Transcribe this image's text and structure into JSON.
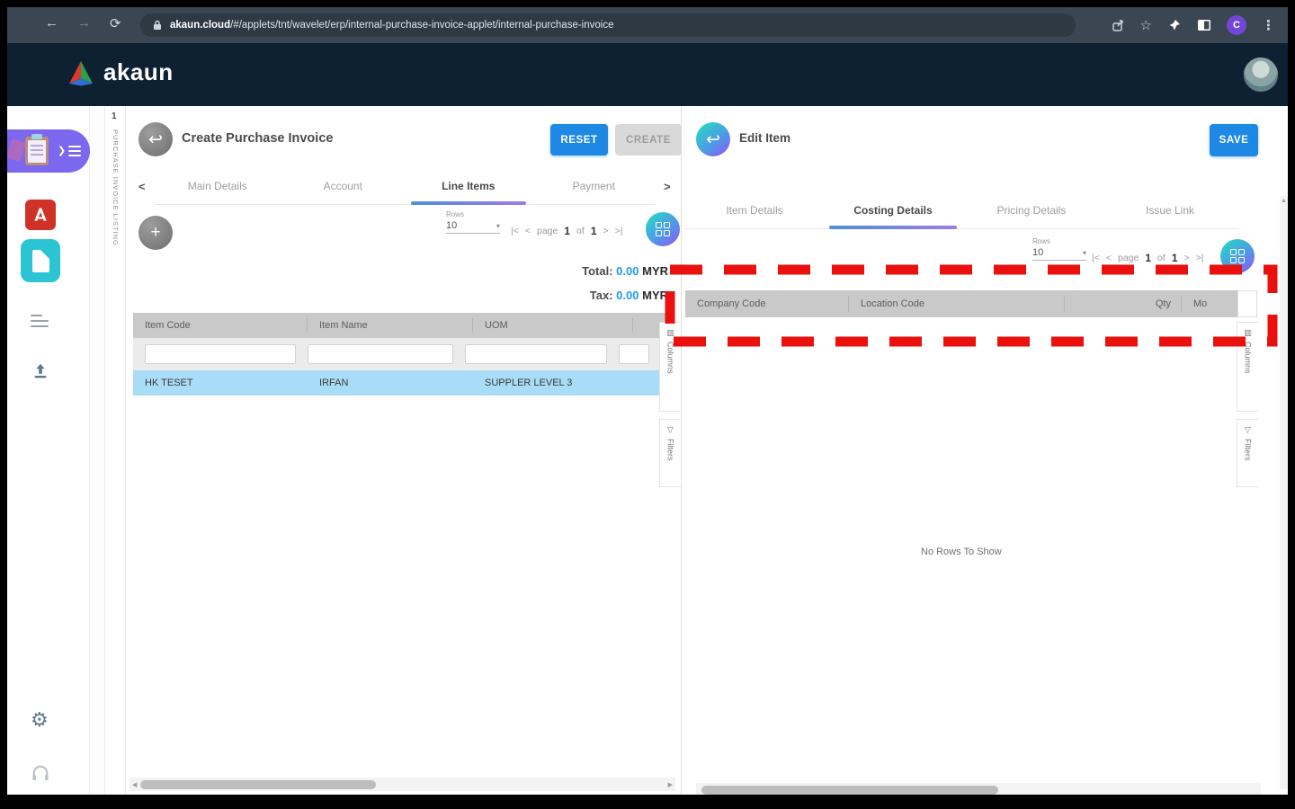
{
  "browser": {
    "url_domain": "akaun.cloud",
    "url_path": "/#/applets/tnt/wavelet/erp/internal-purchase-invoice-applet/internal-purchase-invoice",
    "avatar_letter": "C"
  },
  "brand": {
    "name": "akaun"
  },
  "listing_strip": {
    "index": "1",
    "label": "PURCHASE INVOICE LISTING"
  },
  "left_panel": {
    "title": "Create Purchase Invoice",
    "reset_label": "RESET",
    "create_label": "CREATE",
    "tabs": [
      "Main Details",
      "Account",
      "Line Items",
      "Payment"
    ],
    "active_tab": "Line Items",
    "rows_label": "Rows",
    "rows_value": "10",
    "pager": {
      "first": "|<",
      "prev": "<",
      "page_word": "page",
      "page": "1",
      "of_word": "of",
      "total": "1",
      "next": ">",
      "last": ">|"
    },
    "totals": {
      "total_label": "Total:",
      "total_value": "0.00",
      "tax_label": "Tax:",
      "tax_value": "0.00",
      "currency": "MYR"
    },
    "table": {
      "columns": [
        "Item Code",
        "Item Name",
        "UOM"
      ],
      "rows": [
        [
          "HK TESET",
          "IRFAN",
          "SUPPLER LEVEL 3"
        ]
      ]
    },
    "side_tabs": {
      "columns": "Columns",
      "filters": "Filters"
    }
  },
  "right_panel": {
    "title": "Edit Item",
    "save_label": "SAVE",
    "tabs": [
      "Item Details",
      "Costing Details",
      "Pricing Details",
      "Issue Link"
    ],
    "active_tab": "Costing Details",
    "rows_label": "Rows",
    "rows_value": "10",
    "pager": {
      "first": "|<",
      "prev": "<",
      "page_word": "page",
      "page": "1",
      "of_word": "of",
      "total": "1",
      "next": ">",
      "last": ">|"
    },
    "table": {
      "columns": [
        "Company Code",
        "Location Code",
        "Qty",
        "Mo"
      ],
      "empty_message": "No Rows To Show"
    },
    "side_tabs": {
      "columns": "Columns",
      "filters": "Filters"
    }
  },
  "icons": {
    "back_nav": "←",
    "forward_nav": "→",
    "reload": "⟳",
    "menu_dots": "⋮",
    "star": "☆",
    "back_arrow": "↩",
    "plus": "+",
    "caret_down": "▾",
    "chevron_left": "<",
    "chevron_right": ">",
    "columns_grid": "▥",
    "filter_funnel": "▽",
    "gear": "⚙",
    "scroll_left": "◀",
    "scroll_right": "▶",
    "scroll_up": "▲"
  },
  "colors": {
    "accent_blue": "#1e88e5",
    "value_blue": "#1e9bf0",
    "annotation_red": "#e9100d",
    "header_navy": "#0d2133",
    "chrome_gray": "#3a4652",
    "selected_row_blue": "#a9dcf6",
    "gradient_teal": "#27d8c3",
    "gradient_purple": "#8a5cf0",
    "sidebar_purple": "#7b68ee",
    "pdf_red": "#cf3227",
    "doc_teal": "#2bc4d4",
    "table_header_gray": "#c9c9c9"
  }
}
